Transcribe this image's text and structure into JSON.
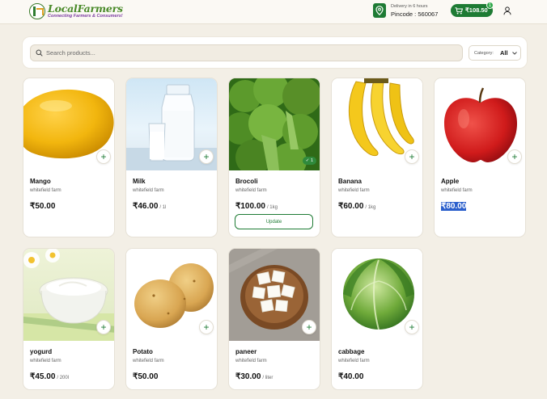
{
  "header": {
    "brand_name": "LocalFarmers",
    "brand_tagline": "Connecting Farmers & Consumers!",
    "delivery_text": "Delivery in 6 hours",
    "pincode_text": "Pincode : 560067",
    "cart_total": "₹108.50",
    "cart_count": "1"
  },
  "search": {
    "placeholder": "Search products...",
    "category_label": "Category:",
    "category_value": "All"
  },
  "products": [
    {
      "name": "Mango",
      "farm": "whitefield farm",
      "price": "₹50.00",
      "unit": ""
    },
    {
      "name": "Milk",
      "farm": "whitefield farm",
      "price": "₹46.00",
      "unit": "/ 1l"
    },
    {
      "name": "Brocoli",
      "farm": "whitefield farm",
      "price": "₹100.00",
      "unit": "/ 1kg",
      "in_cart_qty": "1",
      "update_label": "Update"
    },
    {
      "name": "Banana",
      "farm": "whitefield farm",
      "price": "₹60.00",
      "unit": "/ 1kg"
    },
    {
      "name": "Apple",
      "farm": "whitefield farm",
      "price": "₹80.00",
      "unit": ""
    },
    {
      "name": "yogurd",
      "farm": "whitefield farm",
      "price": "₹45.00",
      "unit": "/ 200l"
    },
    {
      "name": "Potato",
      "farm": "whitefield farm",
      "price": "₹50.00",
      "unit": ""
    },
    {
      "name": "paneer",
      "farm": "whitefield farm",
      "price": "₹30.00",
      "unit": "/ liter"
    },
    {
      "name": "cabbage",
      "farm": "whitefield farm",
      "price": "₹40.00",
      "unit": ""
    }
  ],
  "icons": {
    "location": "location-pin-icon",
    "cart": "cart-icon",
    "user": "user-icon",
    "search": "search-icon",
    "chevron": "chevron-down-icon",
    "add": "plus-icon"
  },
  "colors": {
    "brand_green": "#1e7b34",
    "page_background": "#f3efe6",
    "selection_highlight": "#2b5fcc"
  }
}
